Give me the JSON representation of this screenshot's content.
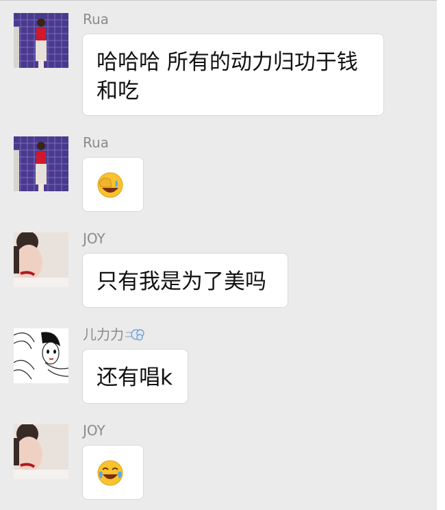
{
  "messages": [
    {
      "sender": "Rua",
      "avatar": "avatar-rua",
      "text": "哈哈哈 所有的动力归功于钱和吃"
    },
    {
      "sender": "Rua",
      "avatar": "avatar-rua",
      "emoji": "face-palm-laughing-emoji"
    },
    {
      "sender": "JOY",
      "avatar": "avatar-joy",
      "text": "只有我是为了美吗"
    },
    {
      "sender": "儿力力",
      "avatar": "avatar-illustration",
      "badge": "dash-cloud-icon",
      "text": "还有唱k"
    },
    {
      "sender": "JOY",
      "avatar": "avatar-joy",
      "emoji": "tears-of-joy-emoji"
    }
  ]
}
